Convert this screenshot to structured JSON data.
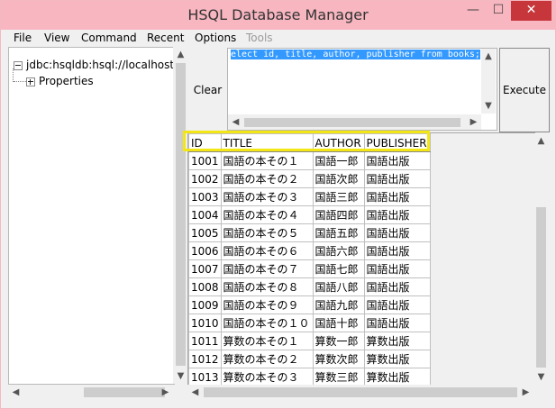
{
  "window": {
    "title": "HSQL Database Manager"
  },
  "menu": {
    "file": "File",
    "view": "View",
    "command": "Command",
    "recent": "Recent",
    "options": "Options",
    "tools": "Tools"
  },
  "tree": {
    "root": "jdbc:hsqldb:hsql://localhost/",
    "child": "Properties"
  },
  "query": {
    "clear_label": "Clear",
    "execute_label": "Execute",
    "sql": "elect id, title, author, publisher from books;"
  },
  "results": {
    "columns": [
      "ID",
      "TITLE",
      "AUTHOR",
      "PUBLISHER"
    ],
    "rows": [
      [
        "1001",
        "国語の本その１",
        "国語一郎",
        "国語出版"
      ],
      [
        "1002",
        "国語の本その２",
        "国語次郎",
        "国語出版"
      ],
      [
        "1003",
        "国語の本その３",
        "国語三郎",
        "国語出版"
      ],
      [
        "1004",
        "国語の本その４",
        "国語四郎",
        "国語出版"
      ],
      [
        "1005",
        "国語の本その５",
        "国語五郎",
        "国語出版"
      ],
      [
        "1006",
        "国語の本その６",
        "国語六郎",
        "国語出版"
      ],
      [
        "1007",
        "国語の本その７",
        "国語七郎",
        "国語出版"
      ],
      [
        "1008",
        "国語の本その８",
        "国語八郎",
        "国語出版"
      ],
      [
        "1009",
        "国語の本その９",
        "国語九郎",
        "国語出版"
      ],
      [
        "1010",
        "国語の本その１０",
        "国語十郎",
        "国語出版"
      ],
      [
        "1011",
        "算数の本その１",
        "算数一郎",
        "算数出版"
      ],
      [
        "1012",
        "算数の本その２",
        "算数次郎",
        "算数出版"
      ],
      [
        "1013",
        "算数の本その３",
        "算数三郎",
        "算数出版"
      ]
    ]
  },
  "colors": {
    "titlebar": "#f7b6c0",
    "close": "#c7363a",
    "selection": "#3399ff",
    "highlight": "#f3e614"
  }
}
